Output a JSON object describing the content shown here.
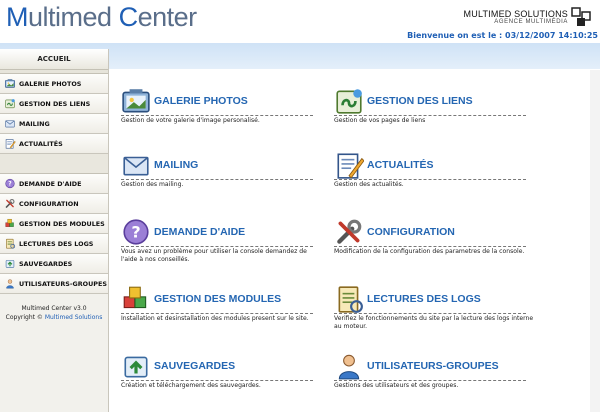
{
  "header": {
    "logo_first_letter": "M",
    "logo_rest": "ultimed",
    "logo_center_letter": "C",
    "logo_center_rest": "enter",
    "brand_name": "Multimed Solutions",
    "brand_sub": "Agence Multimédia",
    "welcome": "Bienvenue   on est le : 03/12/2007 14:10:25"
  },
  "sidebar": {
    "home": "ACCUEIL",
    "group1": [
      {
        "label": "GALERIE PHOTOS",
        "icon": "photo-gallery-icon"
      },
      {
        "label": "GESTION DES LIENS",
        "icon": "links-icon"
      },
      {
        "label": "MAILING",
        "icon": "mail-icon"
      },
      {
        "label": "ACTUALITÉS",
        "icon": "news-icon"
      }
    ],
    "group2": [
      {
        "label": "DEMANDE D'AIDE",
        "icon": "help-icon"
      },
      {
        "label": "CONFIGURATION",
        "icon": "tools-icon"
      },
      {
        "label": "GESTION DES MODULES",
        "icon": "modules-icon"
      },
      {
        "label": "LECTURES DES LOGS",
        "icon": "logs-icon"
      },
      {
        "label": "SAUVEGARDES",
        "icon": "backup-icon"
      },
      {
        "label": "UTILISATEURS-GROUPES",
        "icon": "users-icon"
      }
    ],
    "footer_version": "Multimed Center v3.0",
    "footer_copyright": "Copyright ©",
    "footer_link": "Multimed Solutions"
  },
  "tiles": [
    {
      "title": "GALERIE PHOTOS",
      "desc": "Gestion de votre galerie d'image personalisé.",
      "icon": "photo-gallery-icon"
    },
    {
      "title": "GESTION DES LIENS",
      "desc": "Gestion de vos pages de liens",
      "icon": "links-icon"
    },
    {
      "title": "MAILING",
      "desc": "Gestion des mailing.",
      "icon": "mail-icon"
    },
    {
      "title": "ACTUALITÉS",
      "desc": "Gestion des actualités.",
      "icon": "news-icon"
    },
    {
      "title": "DEMANDE D'AIDE",
      "desc": "Vous avez un problème pour utiliser la console demandez de l'aide à nos conseillés.",
      "icon": "help-icon"
    },
    {
      "title": "CONFIGURATION",
      "desc": "Modification de la configuration des parametres de la console.",
      "icon": "tools-icon"
    },
    {
      "title": "GESTION DES MODULES",
      "desc": "Installation et desinstallation des modules present sur le site.",
      "icon": "modules-icon"
    },
    {
      "title": "LECTURES DES LOGS",
      "desc": "Verifiez le fonctionnements du site par la lecture des logs interne au moteur.",
      "icon": "logs-icon"
    },
    {
      "title": "SAUVEGARDES",
      "desc": "Création et téléchargement des sauvegardes.",
      "icon": "backup-icon"
    },
    {
      "title": "UTILISATEURS-GROUPES",
      "desc": "Gestions des utilisateurs et des groupes.",
      "icon": "users-icon"
    }
  ]
}
